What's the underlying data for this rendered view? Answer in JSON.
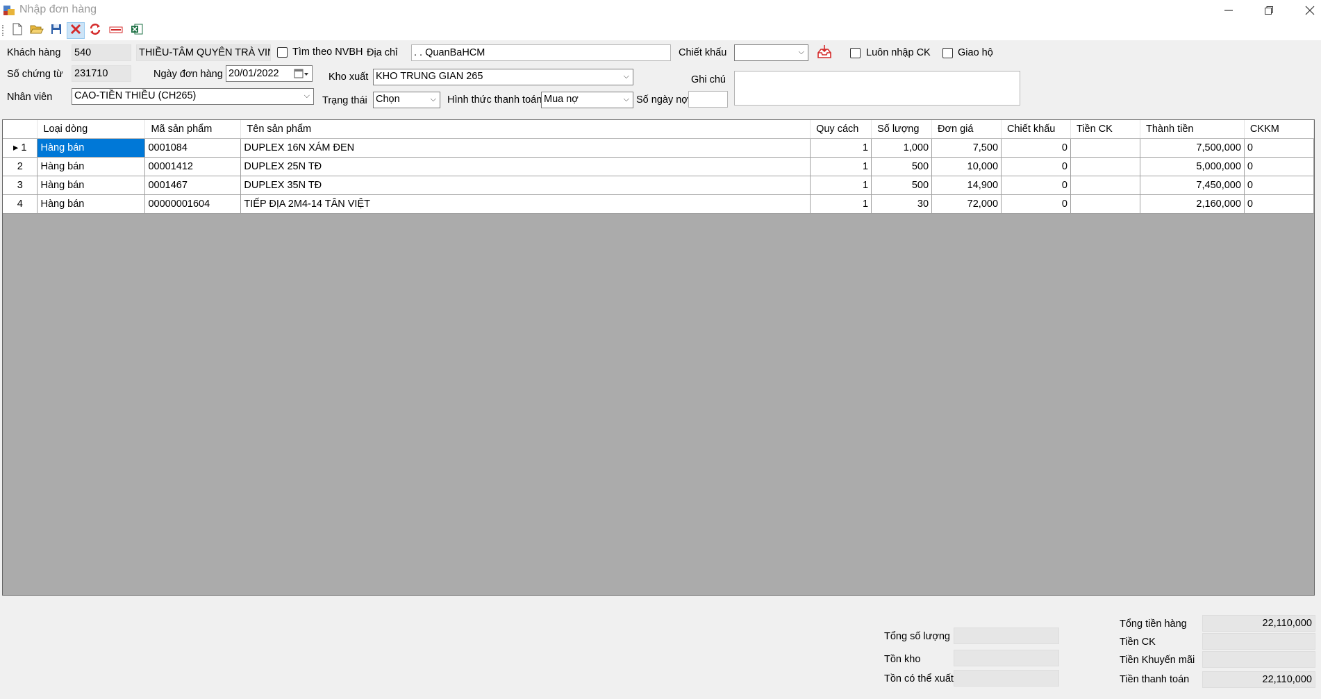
{
  "window": {
    "title": "Nhập đơn hàng"
  },
  "form": {
    "customer_label": "Khách hàng",
    "customer_code": "540",
    "customer_name": "THIỀU-TÂM QUYÊN TRÀ VINI",
    "search_nvbh_label": "Tìm theo NVBH",
    "address_label": "Địa chỉ",
    "address_value": ". . QuanBaHCM",
    "discount_label": "Chiết khấu",
    "discount_value": "",
    "always_ck_label": "Luôn nhập CK",
    "delivery_label": "Giao hộ",
    "voucher_label": "Số chứng từ",
    "voucher_value": "231710",
    "order_date_label": "Ngày đơn hàng",
    "order_date_value": "20/01/2022",
    "warehouse_label": "Kho xuất",
    "warehouse_value": "KHO TRUNG GIAN 265",
    "note_label": "Ghi chú",
    "note_value": "",
    "staff_label": "Nhân viên",
    "staff_value": "CAO-TIỀN THIỀU (CH265)",
    "status_label": "Trạng thái",
    "status_value": "Chọn",
    "payment_label": "Hình thức thanh toán",
    "payment_value": "Mua nợ",
    "debt_days_label": "Số ngày nợ",
    "debt_days_value": ""
  },
  "grid": {
    "columns": [
      "Loại dòng",
      "Mã sản phẩm",
      "Tên sản phẩm",
      "Quy cách",
      "Số lượng",
      "Đơn giá",
      "Chiết khấu",
      "Tiền CK",
      "Thành tiền",
      "CKKM"
    ],
    "rows": [
      {
        "idx": "1",
        "type": "Hàng bán",
        "code": "0001084",
        "name": "DUPLEX 16N XÁM ĐEN",
        "spec": "1",
        "qty": "1,000",
        "price": "7,500",
        "discount": "0",
        "ck": "",
        "total": "7,500,000",
        "ckkm": "0"
      },
      {
        "idx": "2",
        "type": "Hàng bán",
        "code": "00001412",
        "name": "DUPLEX 25N TĐ",
        "spec": "1",
        "qty": "500",
        "price": "10,000",
        "discount": "0",
        "ck": "",
        "total": "5,000,000",
        "ckkm": "0"
      },
      {
        "idx": "3",
        "type": "Hàng bán",
        "code": "0001467",
        "name": "DUPLEX 35N TĐ",
        "spec": "1",
        "qty": "500",
        "price": "14,900",
        "discount": "0",
        "ck": "",
        "total": "7,450,000",
        "ckkm": "0"
      },
      {
        "idx": "4",
        "type": "Hàng bán",
        "code": "00000001604",
        "name": "TIẾP ĐỊA 2M4-14 TÂN VIỆT",
        "spec": "1",
        "qty": "30",
        "price": "72,000",
        "discount": "0",
        "ck": "",
        "total": "2,160,000",
        "ckkm": "0"
      }
    ]
  },
  "footer": {
    "total_qty_label": "Tổng số lượng",
    "total_qty_value": "",
    "stock_label": "Tồn kho",
    "stock_value": "",
    "exportable_label": "Tồn có thể xuất",
    "exportable_value": "",
    "total_goods_label": "Tổng tiền hàng",
    "total_goods_value": "22,110,000",
    "ck_label": "Tiền CK",
    "ck_value": "",
    "promo_label": "Tiền Khuyến mãi",
    "promo_value": "",
    "payment_total_label": "Tiền thanh toán",
    "payment_total_value": "22,110,000"
  },
  "colors": {
    "selection": "#0078d7",
    "grid_bg": "#ababab"
  }
}
